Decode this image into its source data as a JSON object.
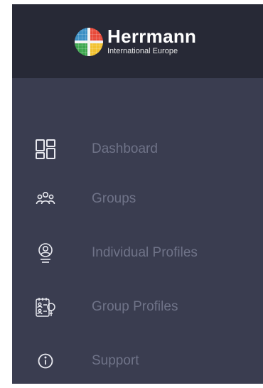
{
  "brand": {
    "name": "Herrmann",
    "tagline": "International Europe",
    "logo_icon": "herrmann-whole-brain-logo",
    "colors": {
      "header_bg": "#272936",
      "sidebar_bg": "#3a3d50",
      "label_color": "#6f7388",
      "icon_color": "#e8e9ef"
    }
  },
  "nav": {
    "items": [
      {
        "label": "Dashboard",
        "icon": "dashboard-icon"
      },
      {
        "label": "Groups",
        "icon": "groups-icon"
      },
      {
        "label": "Individual Profiles",
        "icon": "individual-profile-icon"
      },
      {
        "label": "Group Profiles",
        "icon": "group-profiles-icon"
      },
      {
        "label": "Support",
        "icon": "info-icon"
      }
    ]
  }
}
